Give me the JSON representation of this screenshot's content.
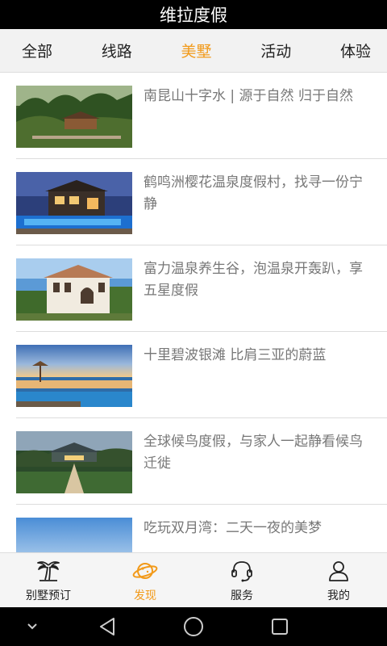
{
  "header": {
    "title": "维拉度假"
  },
  "tabs": [
    {
      "label": "全部",
      "active": false
    },
    {
      "label": "线路",
      "active": false
    },
    {
      "label": "美墅",
      "active": true
    },
    {
      "label": "活动",
      "active": false
    },
    {
      "label": "体验",
      "active": false
    }
  ],
  "articles": [
    {
      "title": "南昆山十字水 | 源于自然 归于自然",
      "thumb": "forest-villa-photo"
    },
    {
      "title": "鹤鸣洲樱花温泉度假村，找寻一份宁静",
      "thumb": "pool-villa-night-photo"
    },
    {
      "title": "富力温泉养生谷，泡温泉开轰趴，享五星度假",
      "thumb": "mediterranean-villa-photo"
    },
    {
      "title": "十里碧波银滩 比肩三亚的蔚蓝",
      "thumb": "infinity-pool-sunset-photo"
    },
    {
      "title": "全球候鸟度假，与家人一起静看候鸟迁徙",
      "thumb": "resort-dusk-photo"
    },
    {
      "title": "吃玩双月湾：二天一夜的美梦",
      "thumb": "sky-photo"
    }
  ],
  "bottom_nav": [
    {
      "label": "别墅预订",
      "icon": "palm-tree-icon",
      "active": false
    },
    {
      "label": "发现",
      "icon": "planet-icon",
      "active": true
    },
    {
      "label": "服务",
      "icon": "headset-icon",
      "active": false
    },
    {
      "label": "我的",
      "icon": "person-icon",
      "active": false
    }
  ],
  "colors": {
    "accent": "#f29a1a",
    "header_bg": "#000000",
    "tab_bg": "#f2f2f2",
    "text_muted": "#777777"
  }
}
